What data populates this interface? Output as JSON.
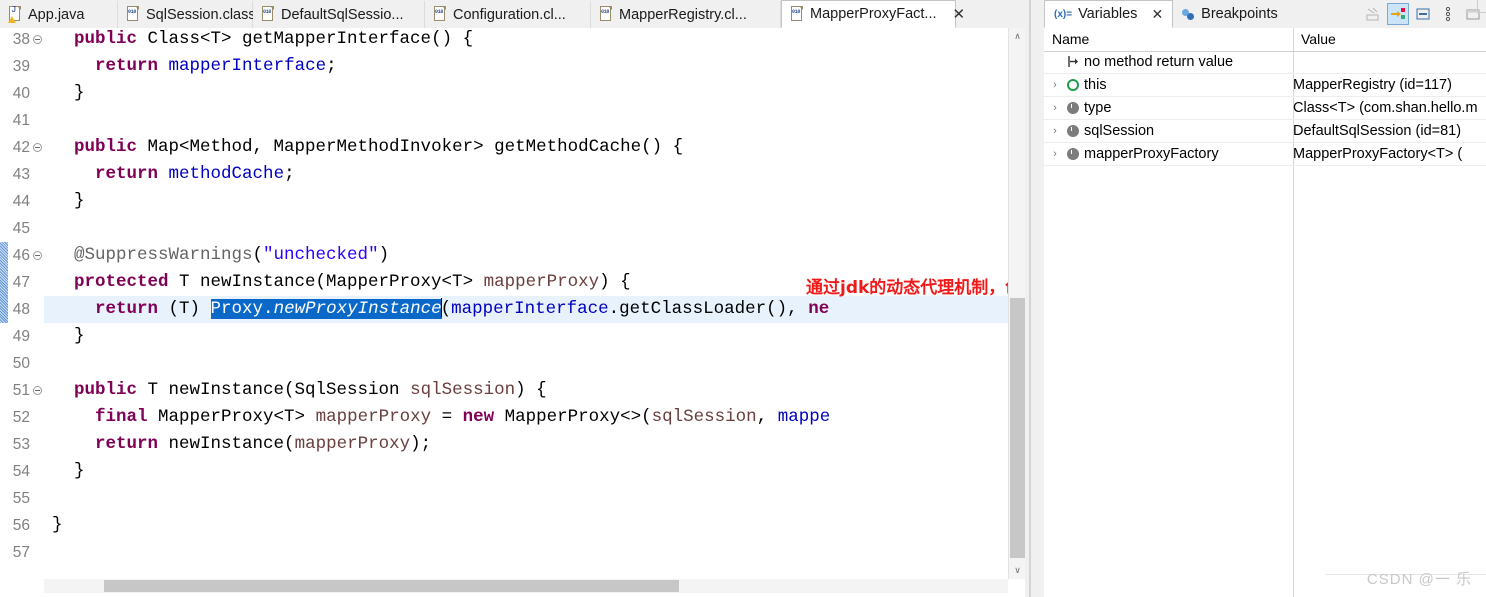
{
  "editor": {
    "tabs": [
      {
        "label": "App.java",
        "icon": "java-file-icon",
        "active": false
      },
      {
        "label": "SqlSession.class",
        "icon": "class-file-icon",
        "active": false
      },
      {
        "label": "DefaultSqlSessio...",
        "icon": "class-file-icon",
        "active": false
      },
      {
        "label": "Configuration.cl...",
        "icon": "class-file-icon",
        "active": false
      },
      {
        "label": "MapperRegistry.cl...",
        "icon": "class-file-icon",
        "active": false
      },
      {
        "label": "MapperProxyFact...",
        "icon": "class-file-icon",
        "active": true
      }
    ],
    "close_label": "✕",
    "lines": [
      {
        "num": "38",
        "fold": true,
        "indent": 1,
        "current": false,
        "tokens": [
          {
            "t": "public",
            "c": "kw"
          },
          {
            "t": " Class<T> getMapperInterface() {",
            "c": "plain"
          }
        ]
      },
      {
        "num": "39",
        "fold": false,
        "indent": 1,
        "current": false,
        "tokens": [
          {
            "t": "  ",
            "c": "plain"
          },
          {
            "t": "return",
            "c": "kw"
          },
          {
            "t": " ",
            "c": "plain"
          },
          {
            "t": "mapperInterface",
            "c": "fld"
          },
          {
            "t": ";",
            "c": "plain"
          }
        ]
      },
      {
        "num": "40",
        "fold": false,
        "indent": 1,
        "current": false,
        "tokens": [
          {
            "t": "}",
            "c": "plain"
          }
        ]
      },
      {
        "num": "41",
        "fold": false,
        "indent": 1,
        "current": false,
        "tokens": []
      },
      {
        "num": "42",
        "fold": true,
        "indent": 1,
        "current": false,
        "tokens": [
          {
            "t": "public",
            "c": "kw"
          },
          {
            "t": " Map<Method, MapperMethodInvoker> getMethodCache() {",
            "c": "plain"
          }
        ]
      },
      {
        "num": "43",
        "fold": false,
        "indent": 1,
        "current": false,
        "tokens": [
          {
            "t": "  ",
            "c": "plain"
          },
          {
            "t": "return",
            "c": "kw"
          },
          {
            "t": " ",
            "c": "plain"
          },
          {
            "t": "methodCache",
            "c": "fld"
          },
          {
            "t": ";",
            "c": "plain"
          }
        ]
      },
      {
        "num": "44",
        "fold": false,
        "indent": 1,
        "current": false,
        "tokens": [
          {
            "t": "}",
            "c": "plain"
          }
        ]
      },
      {
        "num": "45",
        "fold": false,
        "indent": 1,
        "current": false,
        "tokens": []
      },
      {
        "num": "46",
        "fold": true,
        "indent": 1,
        "current": false,
        "tokens": [
          {
            "t": "@SuppressWarnings",
            "c": "ann"
          },
          {
            "t": "(",
            "c": "plain"
          },
          {
            "t": "\"unchecked\"",
            "c": "str"
          },
          {
            "t": ")",
            "c": "plain"
          }
        ]
      },
      {
        "num": "47",
        "fold": false,
        "indent": 1,
        "current": false,
        "tokens": [
          {
            "t": "protected",
            "c": "kw"
          },
          {
            "t": " T newInstance(MapperProxy<T> ",
            "c": "plain"
          },
          {
            "t": "mapperProxy",
            "c": "par"
          },
          {
            "t": ") {",
            "c": "plain"
          }
        ]
      },
      {
        "num": "48",
        "fold": false,
        "indent": 1,
        "current": true,
        "tokens": [
          {
            "t": "  ",
            "c": "plain"
          },
          {
            "t": "return",
            "c": "kw"
          },
          {
            "t": " (T) ",
            "c": "plain"
          },
          {
            "t": "Proxy.",
            "c": "sel"
          },
          {
            "t": "newProxyInstance",
            "c": "sel-it"
          },
          {
            "t": "|caret|",
            "c": "caret"
          },
          {
            "t": "(",
            "c": "plain"
          },
          {
            "t": "mapperInterface",
            "c": "fld"
          },
          {
            "t": ".getClassLoader(), ",
            "c": "plain"
          },
          {
            "t": "ne",
            "c": "kw"
          }
        ]
      },
      {
        "num": "49",
        "fold": false,
        "indent": 1,
        "current": false,
        "tokens": [
          {
            "t": "}",
            "c": "plain"
          }
        ]
      },
      {
        "num": "50",
        "fold": false,
        "indent": 1,
        "current": false,
        "tokens": []
      },
      {
        "num": "51",
        "fold": true,
        "indent": 1,
        "current": false,
        "tokens": [
          {
            "t": "public",
            "c": "kw"
          },
          {
            "t": " T newInstance(SqlSession ",
            "c": "plain"
          },
          {
            "t": "sqlSession",
            "c": "par"
          },
          {
            "t": ") {",
            "c": "plain"
          }
        ]
      },
      {
        "num": "52",
        "fold": false,
        "indent": 1,
        "current": false,
        "tokens": [
          {
            "t": "  ",
            "c": "plain"
          },
          {
            "t": "final",
            "c": "kw"
          },
          {
            "t": " MapperProxy<T> ",
            "c": "plain"
          },
          {
            "t": "mapperProxy",
            "c": "par"
          },
          {
            "t": " = ",
            "c": "plain"
          },
          {
            "t": "new",
            "c": "kw"
          },
          {
            "t": " MapperProxy<>(",
            "c": "plain"
          },
          {
            "t": "sqlSession",
            "c": "par"
          },
          {
            "t": ", ",
            "c": "plain"
          },
          {
            "t": "mappe",
            "c": "fld"
          }
        ]
      },
      {
        "num": "53",
        "fold": false,
        "indent": 1,
        "current": false,
        "tokens": [
          {
            "t": "  ",
            "c": "plain"
          },
          {
            "t": "return",
            "c": "kw"
          },
          {
            "t": " newInstance(",
            "c": "plain"
          },
          {
            "t": "mapperProxy",
            "c": "par"
          },
          {
            "t": ");",
            "c": "plain"
          }
        ]
      },
      {
        "num": "54",
        "fold": false,
        "indent": 1,
        "current": false,
        "tokens": [
          {
            "t": "}",
            "c": "plain"
          }
        ]
      },
      {
        "num": "55",
        "fold": false,
        "indent": 1,
        "current": false,
        "tokens": []
      },
      {
        "num": "56",
        "fold": false,
        "indent": 0,
        "current": false,
        "tokens": [
          {
            "t": "}",
            "c": "plain"
          }
        ]
      },
      {
        "num": "57",
        "fold": false,
        "indent": 0,
        "current": false,
        "tokens": []
      }
    ],
    "annotation": {
      "text": "通过jdk的动态代理机制，创建一个mapper的代理对象",
      "color": "#f11a1a"
    },
    "scroll": {
      "up_arrow": "∧",
      "down_arrow": "∨"
    }
  },
  "debug": {
    "tabs": [
      {
        "label": "Variables",
        "icon": "variables-icon",
        "active": true,
        "closable": true
      },
      {
        "label": "Breakpoints",
        "icon": "breakpoints-icon",
        "active": false,
        "closable": false
      }
    ],
    "close_label": "✕",
    "toolbar": [
      {
        "name": "collapse-all-icon",
        "active": false
      },
      {
        "name": "show-logical-structure-icon",
        "active": true
      },
      {
        "name": "minimize-icon",
        "active": false
      },
      {
        "name": "view-menu-icon",
        "active": false
      },
      {
        "name": "maximize-icon",
        "active": false
      }
    ],
    "columns": [
      "Name",
      "Value"
    ],
    "rows": [
      {
        "arrow": "",
        "icon": "method-return-icon",
        "name": "no method return value",
        "value": ""
      },
      {
        "arrow": "›",
        "icon": "this-icon",
        "name": "this",
        "value": "MapperRegistry  (id=117)"
      },
      {
        "arrow": "›",
        "icon": "field-icon",
        "name": "type",
        "value": "Class<T> (com.shan.hello.m"
      },
      {
        "arrow": "›",
        "icon": "field-icon",
        "name": "sqlSession",
        "value": "DefaultSqlSession  (id=81)"
      },
      {
        "arrow": "›",
        "icon": "field-icon",
        "name": "mapperProxyFactory",
        "value": "MapperProxyFactory<T>  ("
      }
    ],
    "watermark": "CSDN @一 乐"
  }
}
